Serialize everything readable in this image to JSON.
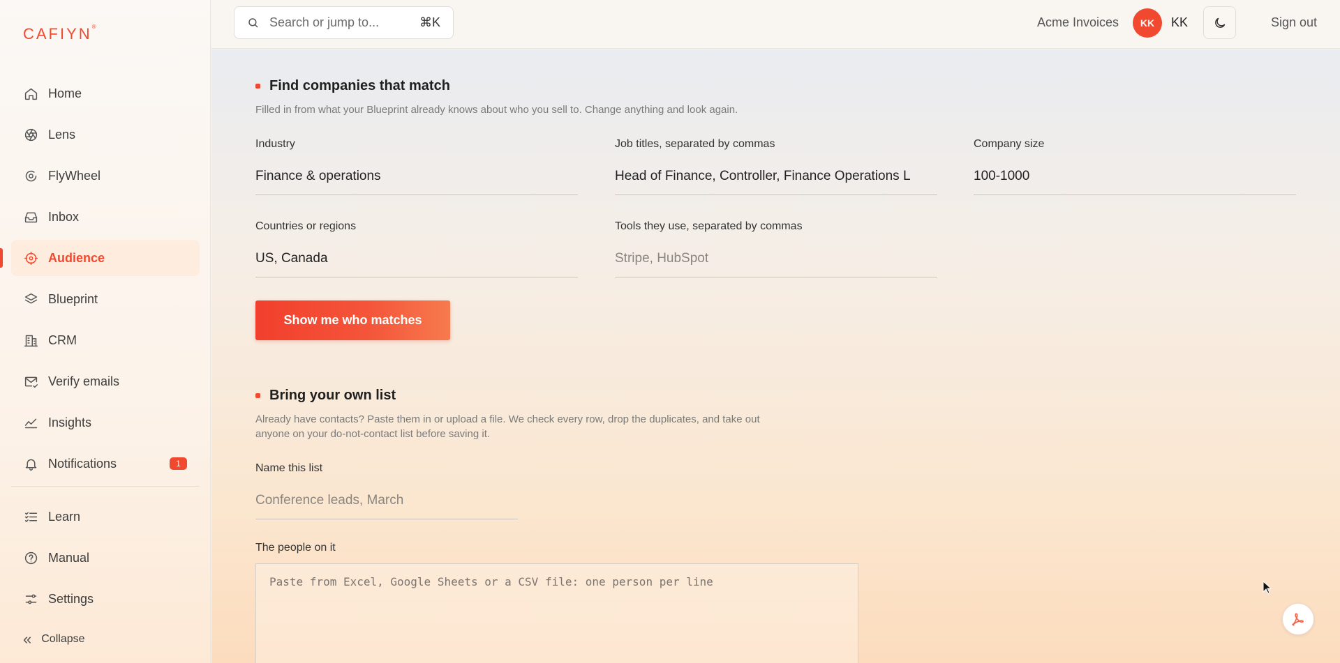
{
  "brand": {
    "logo_text": "CAFIYN",
    "logo_mark": "®",
    "accent": "#f1492f"
  },
  "sidebar": {
    "items": [
      {
        "label": "Home",
        "icon": "home-icon"
      },
      {
        "label": "Lens",
        "icon": "aperture-icon"
      },
      {
        "label": "FlyWheel",
        "icon": "flywheel-icon"
      },
      {
        "label": "Inbox",
        "icon": "inbox-icon"
      },
      {
        "label": "Audience",
        "icon": "crosshair-icon",
        "active": true
      },
      {
        "label": "Blueprint",
        "icon": "layers-icon"
      },
      {
        "label": "CRM",
        "icon": "building-icon"
      },
      {
        "label": "Verify emails",
        "icon": "mail-check-icon"
      },
      {
        "label": "Insights",
        "icon": "chart-line-icon"
      },
      {
        "label": "Notifications",
        "icon": "bell-icon",
        "badge": "1"
      }
    ],
    "bottom_items": [
      {
        "label": "Learn",
        "icon": "list-check-icon"
      },
      {
        "label": "Manual",
        "icon": "help-circle-icon"
      },
      {
        "label": "Settings",
        "icon": "sliders-icon"
      }
    ],
    "collapse_label": "Collapse"
  },
  "topbar": {
    "search_placeholder": "Search or jump to...",
    "search_shortcut": "⌘K",
    "workspace": "Acme Invoices",
    "avatar_initials": "KK",
    "user_name": "KK",
    "signout_label": "Sign out"
  },
  "find": {
    "title": "Find companies that match",
    "description": "Filled in from what your Blueprint already knows about who you sell to. Change anything and look again.",
    "industry": {
      "label": "Industry",
      "value": "Finance & operations"
    },
    "job_titles": {
      "label": "Job titles, separated by commas",
      "value": "Head of Finance, Controller, Finance Operations L"
    },
    "company_size": {
      "label": "Company size",
      "value": "100-1000"
    },
    "countries": {
      "label": "Countries or regions",
      "value": "US, Canada"
    },
    "tools": {
      "label": "Tools they use, separated by commas",
      "placeholder": "Stripe, HubSpot"
    },
    "button_label": "Show me who matches"
  },
  "own_list": {
    "title": "Bring your own list",
    "description_line1": "Already have contacts? Paste them in or upload a file. We check every row, drop the duplicates, and take out",
    "description_line2": "anyone on your do-not-contact list before saving it.",
    "name": {
      "label": "Name this list",
      "placeholder": "Conference leads, March"
    },
    "people": {
      "label": "The people on it",
      "placeholder": "Paste from Excel, Google Sheets or a CSV file: one person per line"
    }
  }
}
